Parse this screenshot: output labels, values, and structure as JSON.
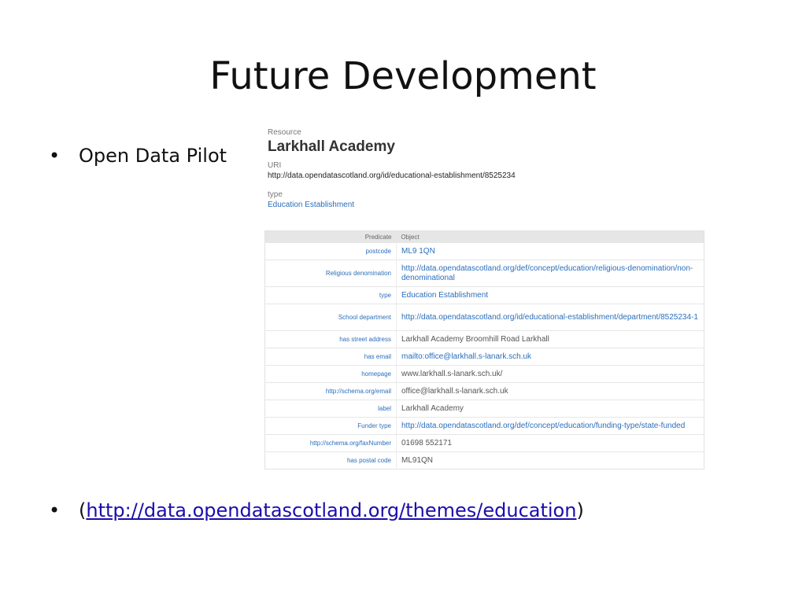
{
  "slide": {
    "title": "Future Development",
    "bullet1": "Open Data Pilot",
    "bullet_symbol": "•",
    "bullet2_open": "(",
    "bullet2_link": "http://data.opendatascotland.org/themes/education",
    "bullet2_close": ")"
  },
  "resource": {
    "resource_label": "Resource",
    "name": "Larkhall Academy",
    "uri_label": "URI",
    "uri": "http://data.opendatascotland.org/id/educational-establishment/8525234",
    "type_label": "type",
    "type_value": "Education Establishment"
  },
  "table": {
    "headers": {
      "predicate": "Predicate",
      "object": "Object"
    },
    "rows": [
      {
        "predicate": "postcode",
        "object": "ML9 1QN",
        "link": true
      },
      {
        "predicate": "Religious denomination",
        "object": "http://data.opendatascotland.org/def/concept/education/religious-denomination/non-denominational",
        "link": true
      },
      {
        "predicate": "type",
        "object": "Education Establishment",
        "link": true
      },
      {
        "predicate": "School department",
        "object": "http://data.opendatascotland.org/id/educational-establishment/department/8525234-1",
        "link": true
      },
      {
        "predicate": "has street address",
        "object": "Larkhall Academy Broomhill Road Larkhall",
        "link": false
      },
      {
        "predicate": "has email",
        "object": "mailto:office@larkhall.s-lanark.sch.uk",
        "link": true
      },
      {
        "predicate": "homepage",
        "object": "www.larkhall.s-lanark.sch.uk/",
        "link": false
      },
      {
        "predicate": "http://schema.org/email",
        "object": "office@larkhall.s-lanark.sch.uk",
        "link": false
      },
      {
        "predicate": "label",
        "object": "Larkhall Academy",
        "link": false
      },
      {
        "predicate": "Funder type",
        "object": "http://data.opendatascotland.org/def/concept/education/funding-type/state-funded",
        "link": true
      },
      {
        "predicate": "http://schema.org/faxNumber",
        "object": "01698 552171",
        "link": false
      },
      {
        "predicate": "has postal code",
        "object": "ML91QN",
        "link": false
      }
    ]
  }
}
